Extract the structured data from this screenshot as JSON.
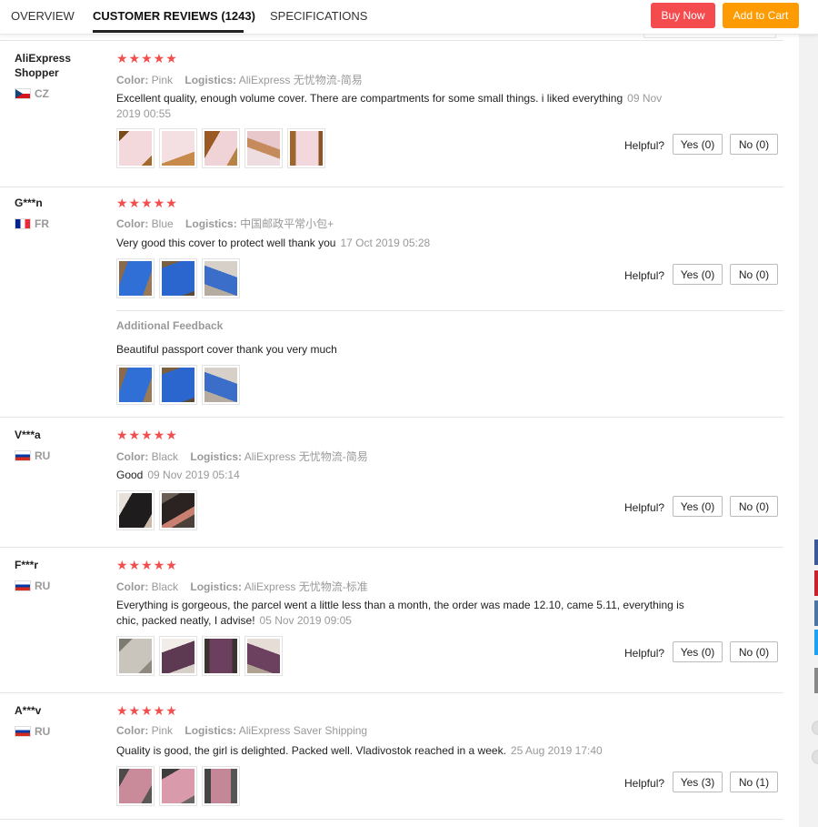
{
  "tabs": [
    {
      "label": "OVERVIEW"
    },
    {
      "label": "CUSTOMER REVIEWS (1243)"
    },
    {
      "label": "SPECIFICATIONS"
    }
  ],
  "buttons": {
    "buy_now": "Buy Now",
    "add_to_cart": "Add to Cart"
  },
  "labels": {
    "helpful": "Helpful?",
    "color": "Color:",
    "logistics": "Logistics:",
    "additional_feedback": "Additional Feedback"
  },
  "stars": "★★★★★",
  "colors": {
    "star": "#f24e4e",
    "buy_now": "#f44b4f",
    "add_to_cart": "#fe9b00"
  },
  "reviews": [
    {
      "user": "AliExpress Shopper",
      "country": "CZ",
      "flag": "cz-flag-icon",
      "color": "Pink",
      "logistics": "AliExpress 无忧物流-简易",
      "text": "Excellent quality, enough volume cover. There are compartments for some small things. i liked everything",
      "date": "09 Nov 2019 00:55",
      "yes": "Yes (0)",
      "no": "No (0)"
    },
    {
      "user": "G***n",
      "country": "FR",
      "flag": "fr-flag-icon",
      "color": "Blue",
      "logistics": "中国邮政平常小包+",
      "text": "Very good this cover to protect well thank you",
      "date": "17 Oct 2019 05:28",
      "yes": "Yes (0)",
      "no": "No (0)",
      "additional_text": "Beautiful passport cover thank you very much"
    },
    {
      "user": "V***a",
      "country": "RU",
      "flag": "ru-flag-icon",
      "color": "Black",
      "logistics": "AliExpress 无忧物流-简易",
      "text": "Good",
      "date": "09 Nov 2019 05:14",
      "yes": "Yes (0)",
      "no": "No (0)"
    },
    {
      "user": "F***r",
      "country": "RU",
      "flag": "ru-flag-icon",
      "color": "Black",
      "logistics": "AliExpress 无忧物流-标准",
      "text": "Everything is gorgeous, the parcel went a little less than a month, the order was made 12.10, came 5.11, everything is chic, packed neatly, I advise!",
      "date": "05 Nov 2019 09:05",
      "yes": "Yes (0)",
      "no": "No (0)"
    },
    {
      "user": "A***v",
      "country": "RU",
      "flag": "ru-flag-icon",
      "color": "Pink",
      "logistics": "AliExpress Saver Shipping",
      "text": "Quality is good, the girl is delighted. Packed well. Vladivostok reached in a week.",
      "date": "25 Aug 2019 17:40",
      "yes": "Yes (3)",
      "no": "No (1)"
    }
  ]
}
